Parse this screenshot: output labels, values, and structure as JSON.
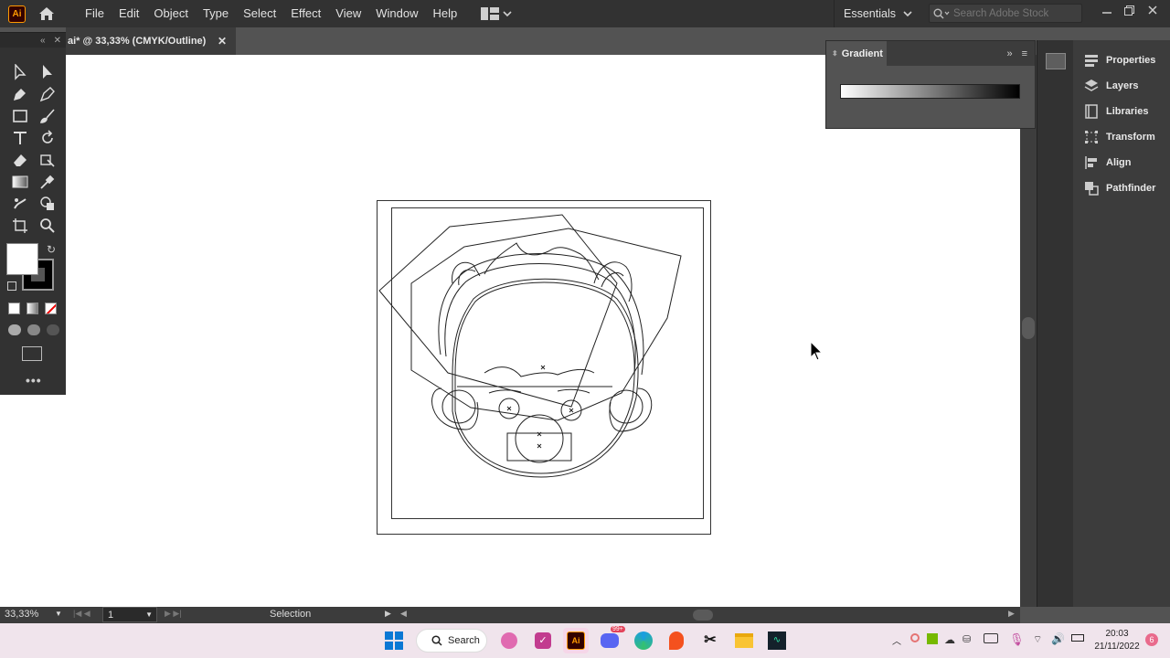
{
  "app": {
    "logo_text": "Ai"
  },
  "menubar": {
    "items": [
      "File",
      "Edit",
      "Object",
      "Type",
      "Select",
      "Effect",
      "View",
      "Window",
      "Help"
    ],
    "workspace": "Essentials",
    "search_placeholder": "Search Adobe Stock"
  },
  "document": {
    "tab_title": "ai* @ 33,33% (CMYK/Outline)"
  },
  "gradient_panel": {
    "title": "Gradient"
  },
  "right_panel": {
    "items": [
      "Properties",
      "Layers",
      "Libraries",
      "Transform",
      "Align",
      "Pathfinder"
    ]
  },
  "statusbar": {
    "zoom": "33,33%",
    "artboard_number": "1",
    "tool_status": "Selection"
  },
  "taskbar": {
    "search_label": "Search",
    "time": "20:03",
    "date": "21/11/2022",
    "notification_count": "6",
    "discord_badge": "99+"
  },
  "colors": {
    "fill": "#ffffff",
    "stroke": "#000000",
    "accent": "#ff9a00"
  }
}
